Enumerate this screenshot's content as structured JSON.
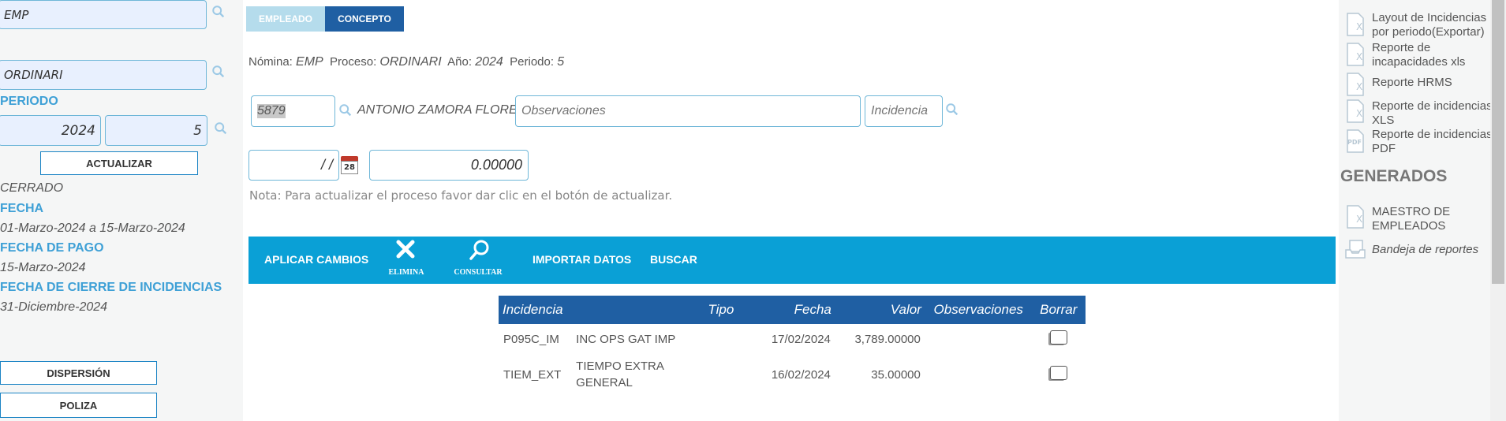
{
  "left": {
    "nomina_value": "EMP",
    "proceso_value": "ORDINARI",
    "periodo_label": "PERIODO",
    "year_value": "2024",
    "period_value": "5",
    "actualizar_label": "ACTUALIZAR",
    "status": "CERRADO",
    "fecha_label": "FECHA",
    "fecha_value": "01-Marzo-2024 a 15-Marzo-2024",
    "fecha_pago_label": "FECHA DE PAGO",
    "fecha_pago_value": "15-Marzo-2024",
    "fecha_cierre_label": "FECHA DE CIERRE DE INCIDENCIAS",
    "fecha_cierre_value": "31-Diciembre-2024",
    "dispersion_label": "DISPERSIÓN",
    "poliza_label": "POLIZA"
  },
  "tabs": [
    {
      "label": "EMPLEADO",
      "active": false
    },
    {
      "label": "CONCEPTO",
      "active": true
    }
  ],
  "info": {
    "nomina_label": "Nómina:",
    "nomina_value": "EMP",
    "proceso_label": "Proceso:",
    "proceso_value": "ORDINARI",
    "anio_label": "Año:",
    "anio_value": "2024",
    "periodo_label": "Periodo:",
    "periodo_value": "5"
  },
  "form": {
    "employee_id": "5879",
    "employee_name": "ANTONIO ZAMORA FLORES",
    "observaciones_placeholder": "Observaciones",
    "incidencia_placeholder": "Incidencia",
    "date_value": "/ /",
    "calendar_day": "28",
    "amount_value": "0.00000",
    "note": "Nota: Para actualizar el proceso favor dar clic en el botón de actualizar."
  },
  "toolbar": {
    "aplicar": "APLICAR CAMBIOS",
    "elimina": "ELIMINA",
    "consultar": "CONSULTAR",
    "importar": "IMPORTAR DATOS",
    "buscar": "BUSCAR"
  },
  "table": {
    "headers": [
      "Incidencia",
      "Tipo",
      "Fecha",
      "Valor",
      "Observaciones",
      "Borrar"
    ],
    "rows": [
      {
        "code": "P095C_IM",
        "desc": "INC OPS GAT IMP",
        "tipo": "",
        "fecha": "17/02/2024",
        "valor": "3,789.00000",
        "obs": ""
      },
      {
        "code": "TIEM_EXT",
        "desc": "TIEMPO EXTRA GENERAL",
        "tipo": "",
        "fecha": "16/02/2024",
        "valor": "35.00000",
        "obs": ""
      }
    ]
  },
  "right": {
    "reports": [
      {
        "label": "Layout de Incidencias por periodo(Exportar)",
        "icon": "xls-doc-icon"
      },
      {
        "label": "Reporte de incapacidades xls",
        "icon": "xls-doc-icon"
      },
      {
        "label": "Reporte HRMS",
        "icon": "xls-doc-icon"
      },
      {
        "label": "Reporte de incidencias XLS",
        "icon": "xls-doc-icon"
      },
      {
        "label": "Reporte de incidencias PDF",
        "icon": "pdf-doc-icon"
      }
    ],
    "generados_title": "GENERADOS",
    "maestro": "MAESTRO DE EMPLEADOS",
    "bandeja": "Bandeja de reportes"
  },
  "colors": {
    "accent": "#0aa0d6",
    "tab_active": "#1f5fa3",
    "tab_inactive": "#b5dcec",
    "label_blue": "#3ea0d6"
  }
}
